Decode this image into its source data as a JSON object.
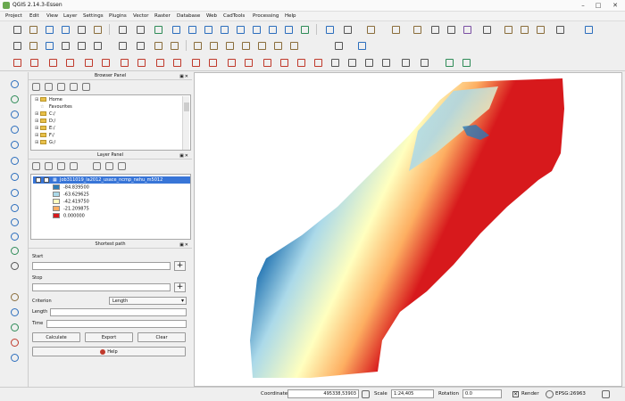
{
  "window": {
    "title": "QGIS 2.14.3-Essen"
  },
  "menu": [
    "Project",
    "Edit",
    "View",
    "Layer",
    "Settings",
    "Plugins",
    "Vector",
    "Raster",
    "Database",
    "Web",
    "CadTools",
    "Processing",
    "Help"
  ],
  "browser_panel": {
    "title": "Browser Panel",
    "items": [
      "Home",
      "Favourites",
      "C:/",
      "D:/",
      "E:/",
      "F:/",
      "G:/"
    ]
  },
  "layers_panel": {
    "title": "Layer Panel",
    "layer_name": "Job311019_la2012_usace_ncmp_nehu_m5012",
    "legend": [
      {
        "value": "-84.839500",
        "color": "#2c7bb6"
      },
      {
        "value": "-63.629625",
        "color": "#abd9e9"
      },
      {
        "value": "-42.419750",
        "color": "#ffffbf"
      },
      {
        "value": "-21.209875",
        "color": "#fdae61"
      },
      {
        "value": "0.000000",
        "color": "#d7191c"
      }
    ]
  },
  "shortest_path": {
    "title": "Shortest path",
    "start_label": "Start",
    "stop_label": "Stop",
    "criterion_label": "Criterion",
    "criterion_value": "Length",
    "length_label": "Length",
    "time_label": "Time",
    "pick_symbol": "+",
    "calculate": "Calculate",
    "export": "Export",
    "clear": "Clear",
    "help": "Help"
  },
  "status": {
    "coordinate_label": "Coordinate",
    "coordinate": "495338,53903",
    "scale_label": "Scale",
    "scale": "1:24,405",
    "rotation_label": "Rotation",
    "rotation": "0.0",
    "render_label": "Render",
    "crs": "EPSG:26963"
  }
}
